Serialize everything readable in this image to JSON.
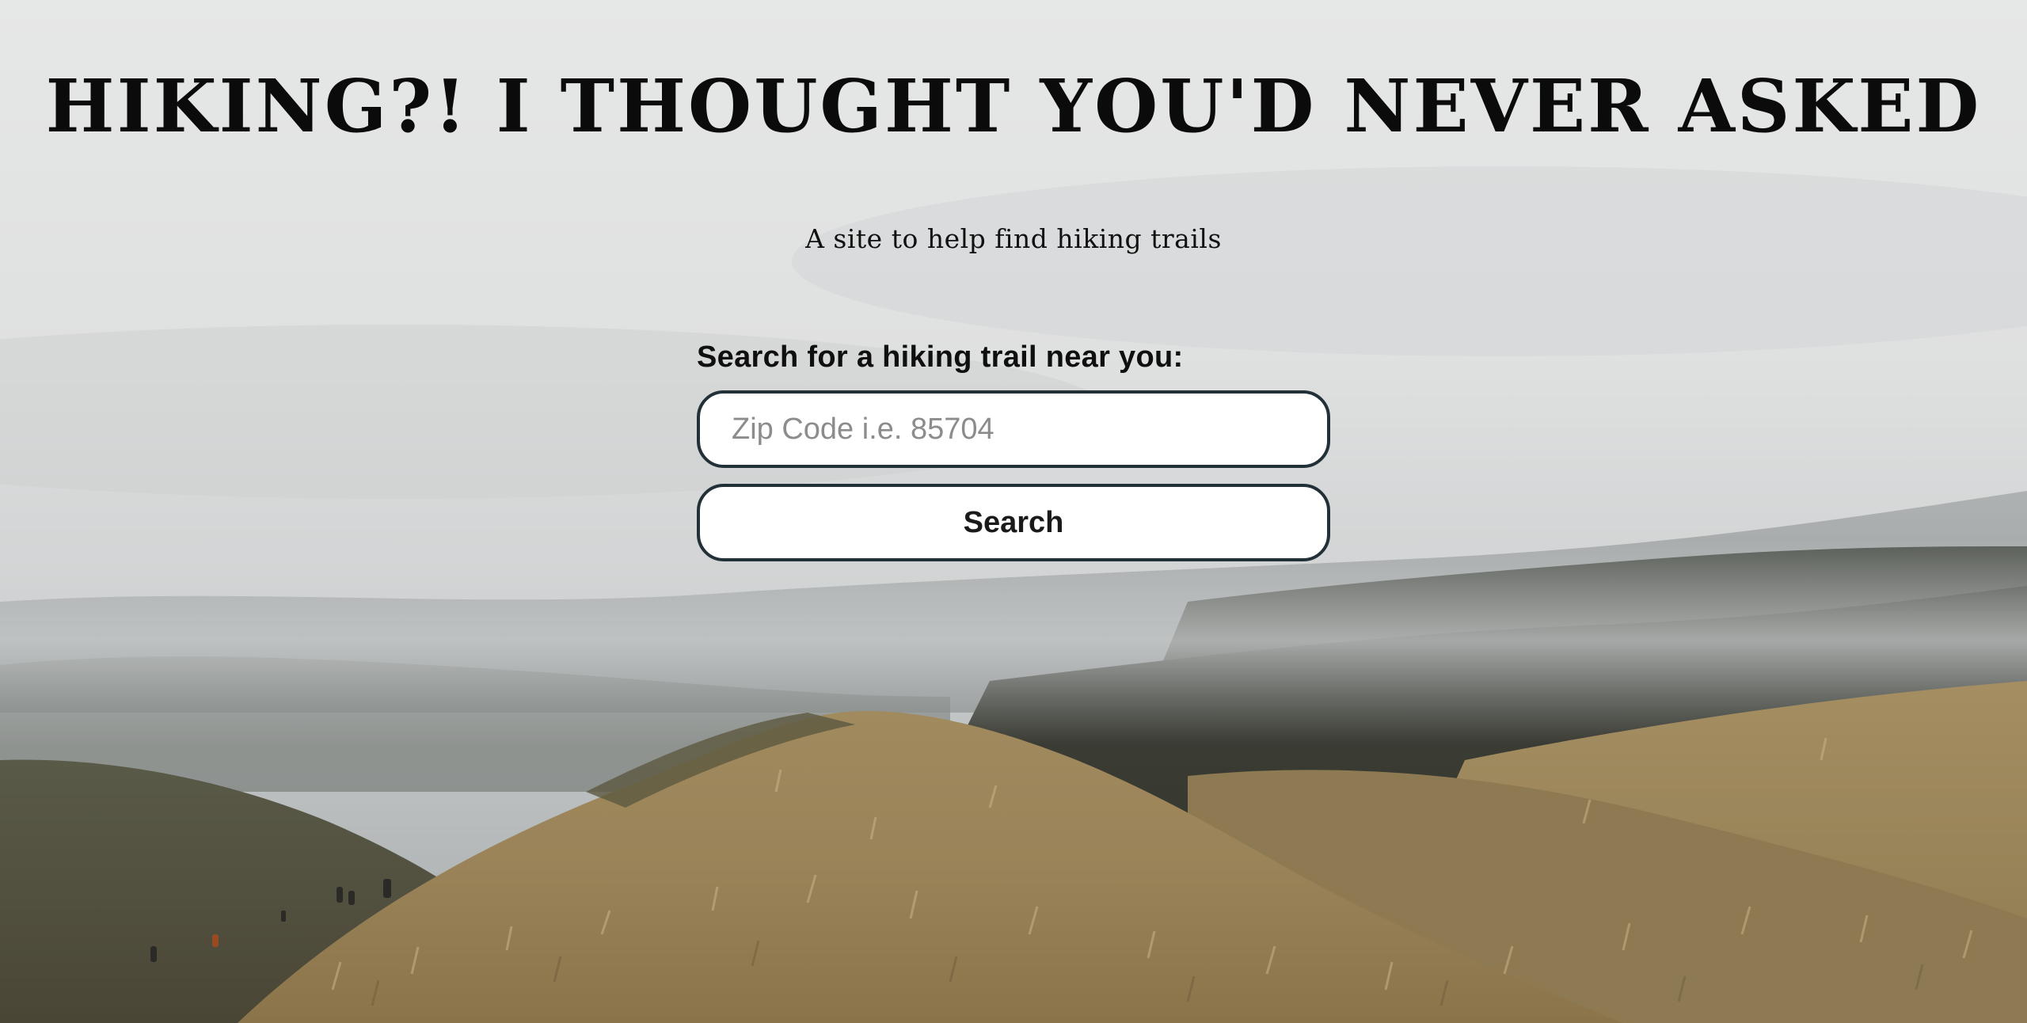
{
  "hero": {
    "title": "HIKING?! I THOUGHT YOU'D NEVER ASKED",
    "subtitle": "A site to help find hiking trails"
  },
  "search": {
    "label": "Search for a hiking trail near you:",
    "zip_placeholder": "Zip Code i.e. 85704",
    "zip_value": "",
    "button_label": "Search"
  },
  "colors": {
    "input_border": "#223038",
    "title_text": "#0b0b0b",
    "sky": "#e9eaea",
    "grass": "#a08a5e"
  }
}
